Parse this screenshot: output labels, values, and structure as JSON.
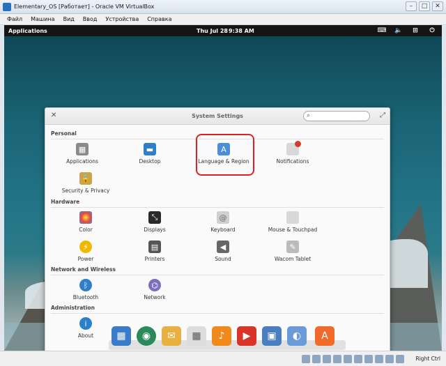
{
  "vbox": {
    "title": "Elementary_OS [Работает] - Oracle VM VirtualBox",
    "menu": [
      "Файл",
      "Машина",
      "Вид",
      "Ввод",
      "Устройства",
      "Справка"
    ],
    "host_key": "Right Ctrl"
  },
  "panel": {
    "applications": "Applications",
    "date": "Thu Jul 28",
    "time": "9:38 AM"
  },
  "settings": {
    "title": "System Settings",
    "search_value": "",
    "categories": {
      "personal": "Personal",
      "hardware": "Hardware",
      "network": "Network and Wireless",
      "administration": "Administration"
    },
    "personal": [
      {
        "label": "Applications",
        "icon": "applications-icon",
        "color": "#8a8a8a"
      },
      {
        "label": "Desktop",
        "icon": "desktop-icon",
        "color": "#2f7fc8"
      },
      {
        "label": "Language & Region",
        "icon": "language-icon",
        "color": "#4a8ed6"
      },
      {
        "label": "Notifications",
        "icon": "notifications-icon",
        "color": "#d23a2a"
      },
      {
        "label": "Security & Privacy",
        "icon": "lock-icon",
        "color": "#c9a44a"
      }
    ],
    "hardware": [
      {
        "label": "Color",
        "icon": "color-icon",
        "color": "#e8a23a"
      },
      {
        "label": "Displays",
        "icon": "displays-icon",
        "color": "#2a2a2a"
      },
      {
        "label": "Keyboard",
        "icon": "keyboard-icon",
        "color": "#b8b8b8"
      },
      {
        "label": "Mouse & Touchpad",
        "icon": "mouse-icon",
        "color": "#b8b8b8"
      },
      {
        "label": "Power",
        "icon": "power-icon",
        "color": "#f0b800"
      },
      {
        "label": "Printers",
        "icon": "printer-icon",
        "color": "#555555"
      },
      {
        "label": "Sound",
        "icon": "sound-icon",
        "color": "#555555"
      },
      {
        "label": "Wacom Tablet",
        "icon": "wacom-icon",
        "color": "#aaaaaa"
      }
    ],
    "network": [
      {
        "label": "Bluetooth",
        "icon": "bluetooth-icon",
        "color": "#2f7fc8"
      },
      {
        "label": "Network",
        "icon": "network-icon",
        "color": "#7b6fbf"
      }
    ],
    "administration": [
      {
        "label": "About",
        "icon": "about-icon",
        "color": "#2f7fc8"
      }
    ]
  },
  "dock": [
    {
      "icon": "multitasking-icon",
      "color": "#3a7cc8"
    },
    {
      "icon": "browser-icon",
      "color": "#2a8a5a"
    },
    {
      "icon": "mail-icon",
      "color": "#e8b040"
    },
    {
      "icon": "calendar-icon",
      "color": "#dcdcdc"
    },
    {
      "icon": "music-icon",
      "color": "#f08a1c"
    },
    {
      "icon": "videos-icon",
      "color": "#d8342a"
    },
    {
      "icon": "photos-icon",
      "color": "#4a7fbf"
    },
    {
      "icon": "switchboard-icon",
      "color": "#6a9ad8"
    },
    {
      "icon": "appcenter-icon",
      "color": "#f06a2a"
    }
  ],
  "accent": "#e02020"
}
